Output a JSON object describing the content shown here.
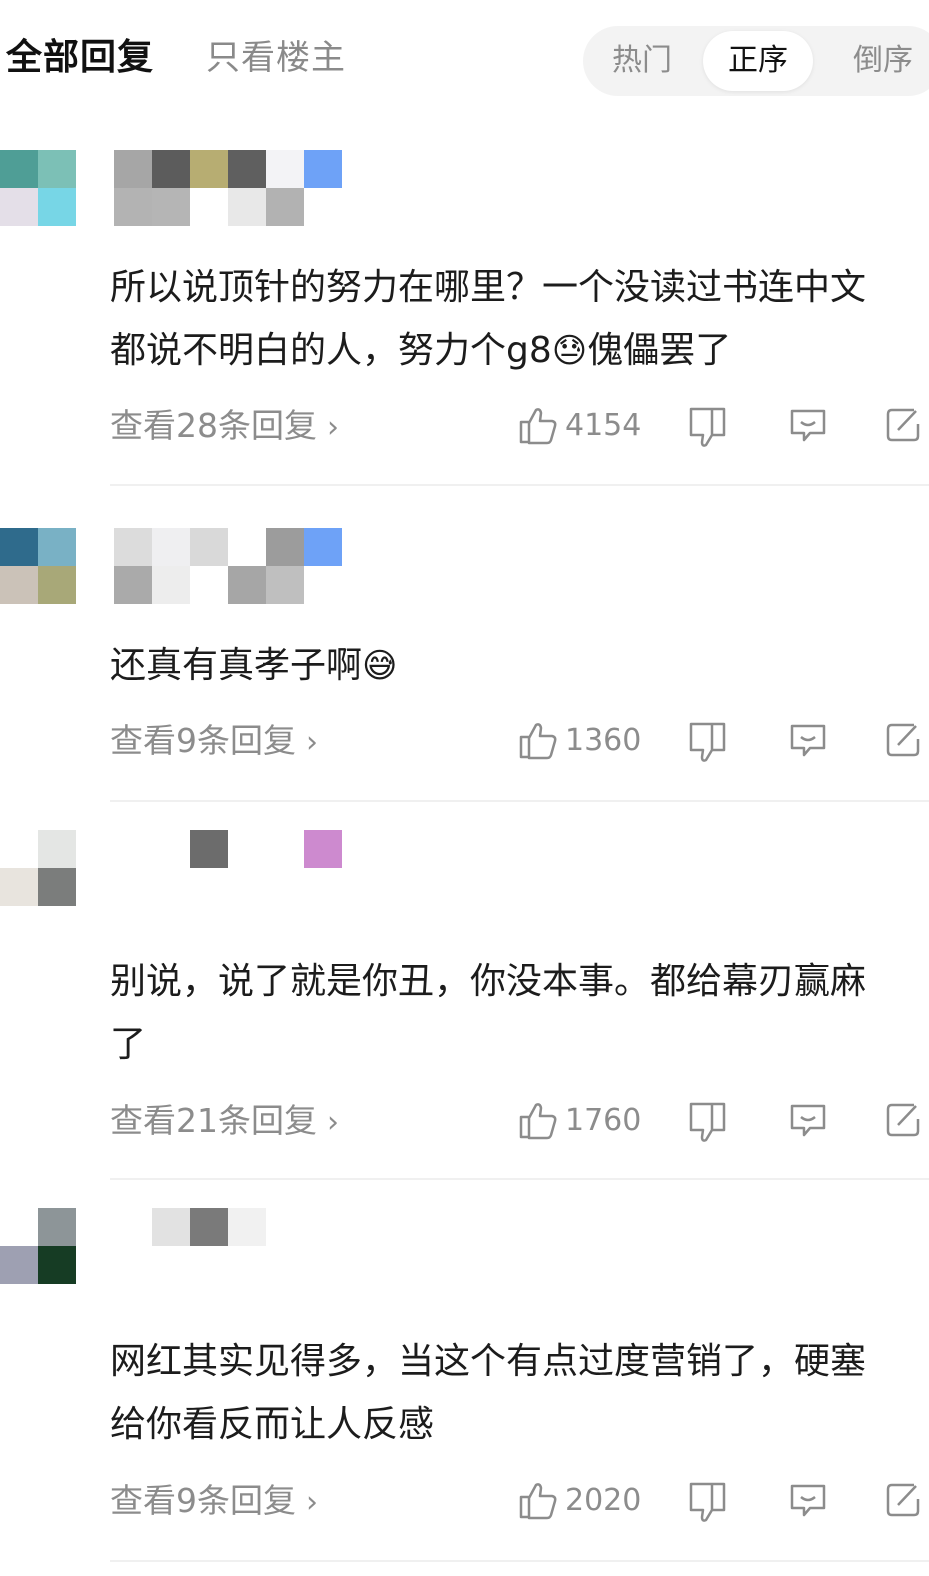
{
  "header": {
    "all_replies": "全部回复",
    "only_op": "只看楼主",
    "sort_hot": "热门",
    "sort_asc": "正序",
    "sort_desc": "倒序"
  },
  "comments": [
    {
      "lines": [
        "所以说顶针的努力在哪里？一个没读过书连中文",
        "都说不明白的人，努力个g8"
      ],
      "emoji": "😓",
      "tail": "傀儡罢了",
      "replies": "查看28条回复",
      "likes": "4154"
    },
    {
      "lines": [
        "还真有真孝子啊"
      ],
      "emoji": "😅",
      "tail": "",
      "replies": "查看9条回复",
      "likes": "1360"
    },
    {
      "lines": [
        "别说，说了就是你丑，你没本事。都给幕刃赢麻",
        "了"
      ],
      "emoji": "",
      "tail": "",
      "replies": "查看21条回复",
      "likes": "1760"
    },
    {
      "lines": [
        "网红其实见得多，当这个有点过度营销了，硬塞",
        "给你看反而让人反感"
      ],
      "emoji": "",
      "tail": "",
      "replies": "查看9条回复",
      "likes": "2020"
    }
  ],
  "icons": {
    "like": "thumbs-up-icon",
    "dislike": "thumbs-down-icon",
    "comment": "comment-bubble-icon",
    "share": "share-icon",
    "chevron": "chevron-right-icon"
  },
  "colors": {
    "muted_text": "#8c8c8c",
    "body_text": "#1c1c1c",
    "sort_bg": "#f3f3f3",
    "divider": "#f0f0f0"
  }
}
